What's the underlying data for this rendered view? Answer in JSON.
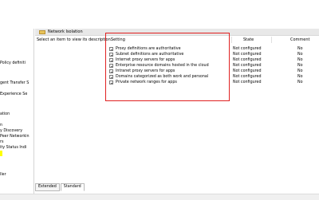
{
  "left_tree": {
    "items": [
      {
        "label": "Policy definiti"
      },
      {
        "label": "gent Transfer S"
      },
      {
        "label": "Experience Se"
      },
      {
        "label": "ation"
      },
      {
        "label": "n"
      },
      {
        "label": "y Discovery"
      },
      {
        "label": "Peer Networkin"
      },
      {
        "label": "rs"
      },
      {
        "label": "ity Status Indi"
      },
      {
        "label": ""
      },
      {
        "label": "ller"
      }
    ]
  },
  "folder": {
    "title": "Network Isolation"
  },
  "description": {
    "text": "Select an item to view its description."
  },
  "columns": {
    "setting": "Setting",
    "state": "State",
    "comment": "Comment"
  },
  "policies": [
    {
      "setting": "Proxy definitions are authoritative",
      "state": "Not configured",
      "comment": "No"
    },
    {
      "setting": "Subnet definitions are authoritative",
      "state": "Not configured",
      "comment": "No"
    },
    {
      "setting": "Internet proxy servers for apps",
      "state": "Not configured",
      "comment": "No"
    },
    {
      "setting": "Enterprise resource domains hosted in the cloud",
      "state": "Not configured",
      "comment": "No"
    },
    {
      "setting": "Intranet proxy servers for  apps",
      "state": "Not configured",
      "comment": "No"
    },
    {
      "setting": "Domains categorized as both work and personal",
      "state": "Not configured",
      "comment": "No"
    },
    {
      "setting": "Private network ranges for  apps",
      "state": "Not configured",
      "comment": "No"
    }
  ],
  "tabs": [
    {
      "label": "Extended"
    },
    {
      "label": "Standard"
    }
  ],
  "colors": {
    "highlight_box": "#e02020",
    "selected_tree_item": "#ffff00",
    "header_bg": "#e8e8e8"
  }
}
